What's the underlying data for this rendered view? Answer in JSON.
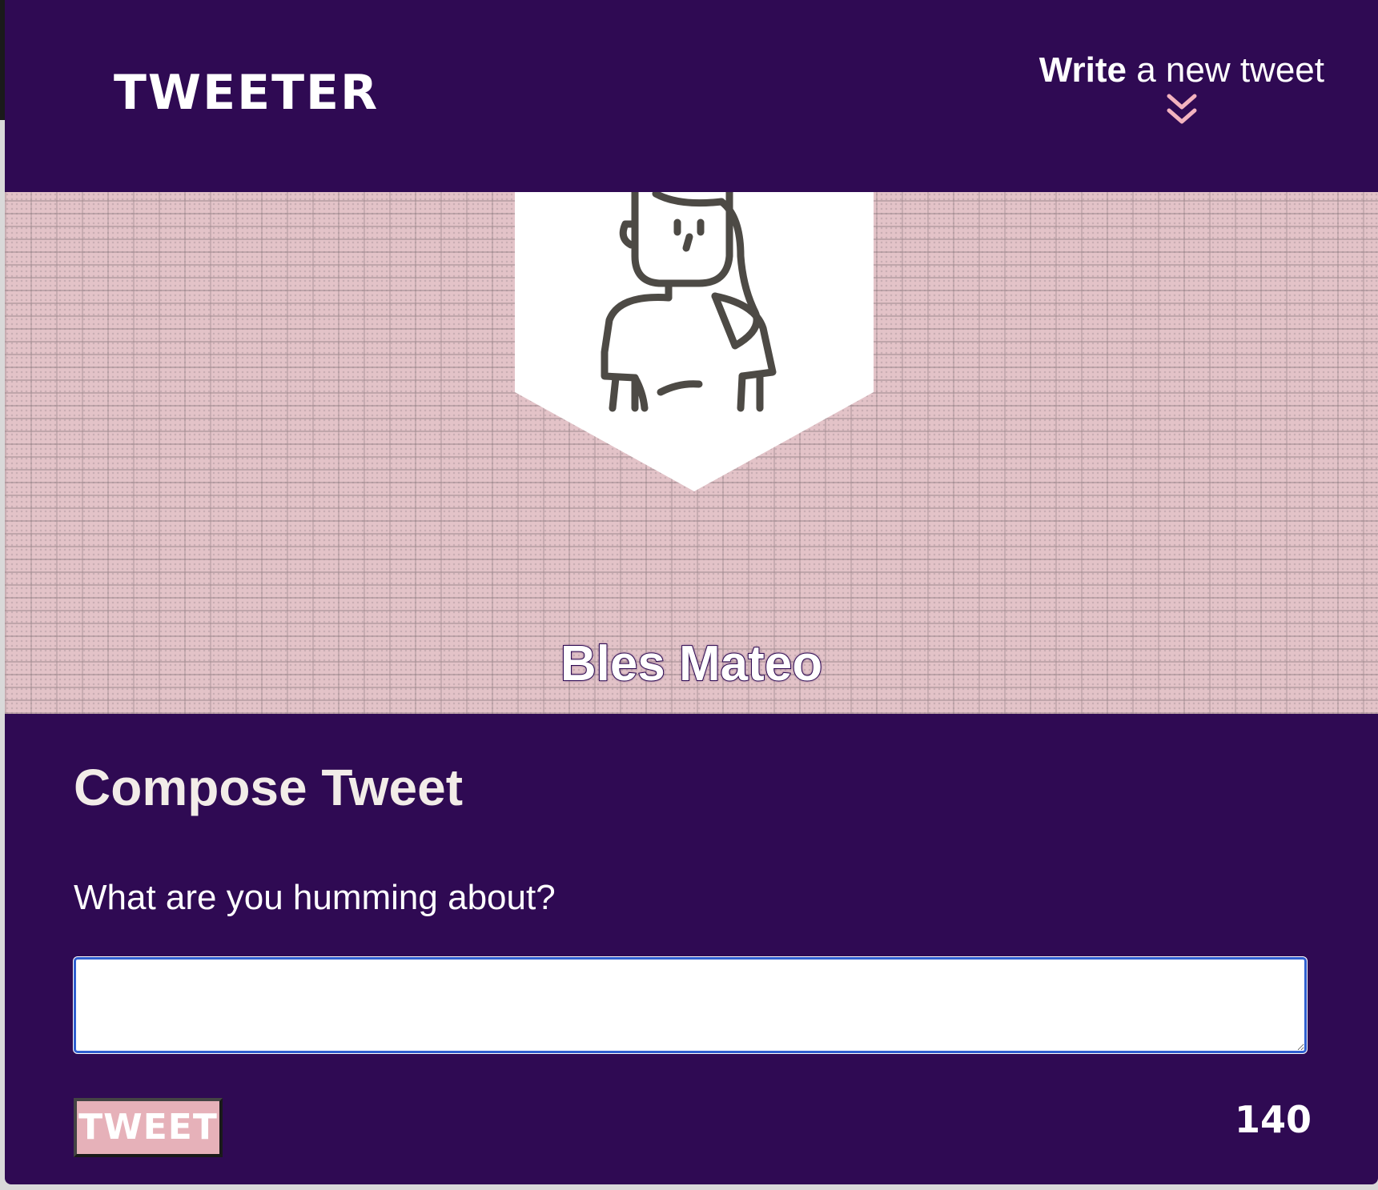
{
  "nav": {
    "brand": "TWEETER",
    "compose_toggle": {
      "strong": "Write",
      "rest": " a new tweet",
      "icon": "double-chevron-down-icon"
    }
  },
  "profile": {
    "avatar_icon": "person-avatar-icon",
    "name": "Bles Mateo"
  },
  "compose": {
    "title": "Compose Tweet",
    "prompt": "What are you humming about?",
    "textarea_value": "",
    "button_label": "TWEET",
    "counter": "140"
  },
  "colors": {
    "primary": "#2f0a53",
    "accent": "#e6b1b9",
    "chevron": "#f3b3bf",
    "text": "#ffffff"
  }
}
